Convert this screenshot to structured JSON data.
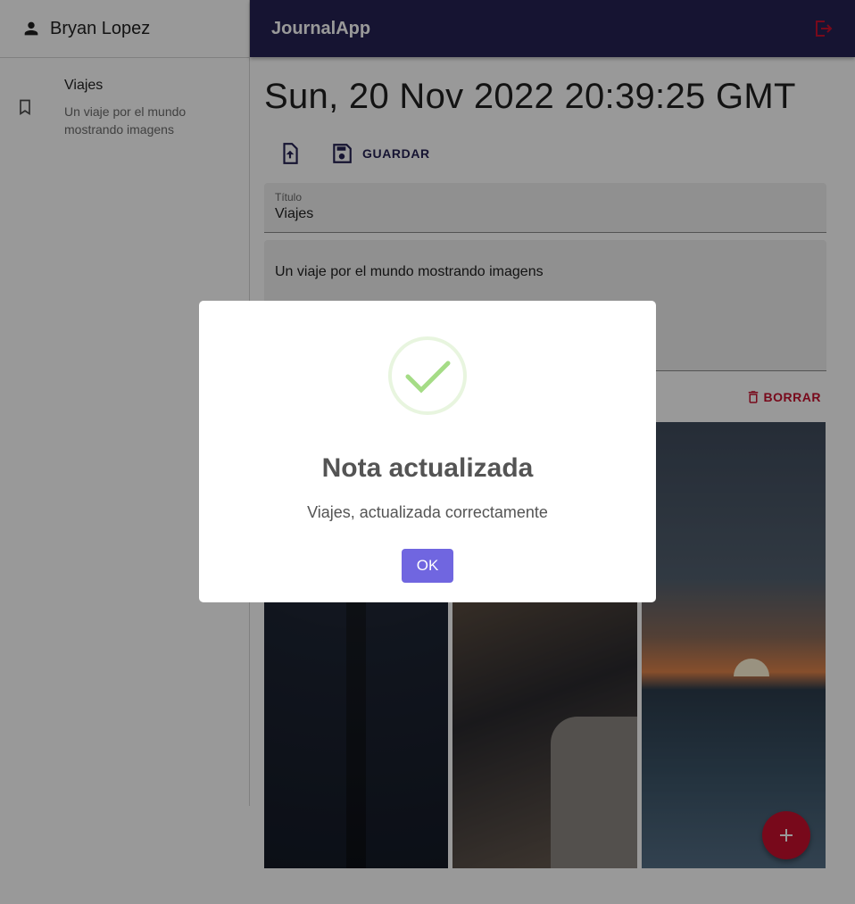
{
  "sidebar": {
    "user_name": "Bryan Lopez",
    "notes": [
      {
        "title": "Viajes",
        "body": "Un viaje por el mundo mostrando imagens"
      }
    ]
  },
  "appbar": {
    "title": "JournalApp"
  },
  "main": {
    "date": "Sun, 20 Nov 2022 20:39:25 GMT",
    "save_label": "GUARDAR",
    "title_field": {
      "label": "Título",
      "value": "Viajes"
    },
    "body_field": {
      "value": "Un viaje por el mundo mostrando imagens"
    },
    "delete_label": "BORRAR"
  },
  "modal": {
    "title": "Nota actualizada",
    "text": "Viajes, actualizada correctamente",
    "ok_label": "OK"
  },
  "icons": {
    "user": "person-icon",
    "note": "bookmark-icon",
    "logout": "logout-icon",
    "upload": "upload-file-icon",
    "save": "save-icon",
    "delete": "trash-icon",
    "add": "plus-icon",
    "success": "check-icon"
  },
  "colors": {
    "appbar": "#262254",
    "accent_red": "#c8102e",
    "ok_button": "#7066e0",
    "success": "#a5dc86"
  }
}
